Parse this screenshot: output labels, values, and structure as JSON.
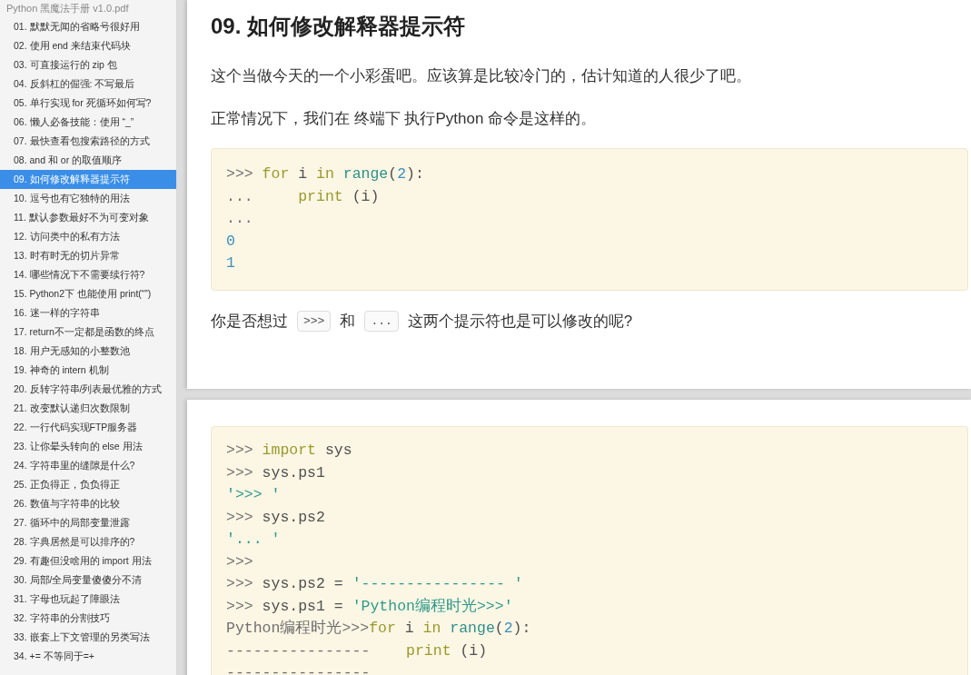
{
  "document": {
    "title": "Python 黑魔法手册 v1.0.pdf"
  },
  "outline": [
    {
      "label": "01. 默默无闻的省略号很好用",
      "selected": false
    },
    {
      "label": "02. 使用 end 来结束代码块",
      "selected": false
    },
    {
      "label": "03. 可直接运行的 zip 包",
      "selected": false
    },
    {
      "label": "04. 反斜杠的倔强: 不写最后",
      "selected": false
    },
    {
      "label": "05. 单行实现 for 死循环如何写?",
      "selected": false
    },
    {
      "label": "06. 懒人必备技能：使用 “_”",
      "selected": false
    },
    {
      "label": "07. 最快查看包搜索路径的方式",
      "selected": false
    },
    {
      "label": "08. and 和 or 的取值顺序",
      "selected": false
    },
    {
      "label": "09. 如何修改解释器提示符",
      "selected": true
    },
    {
      "label": "10. 逗号也有它独特的用法",
      "selected": false
    },
    {
      "label": "11. 默认参数最好不为可变对象",
      "selected": false
    },
    {
      "label": "12. 访问类中的私有方法",
      "selected": false
    },
    {
      "label": "13. 时有时无的切片异常",
      "selected": false
    },
    {
      "label": "14. 哪些情况下不需要续行符?",
      "selected": false
    },
    {
      "label": "15. Python2下 也能使用 print(“”)",
      "selected": false
    },
    {
      "label": "16. 迷一样的字符串",
      "selected": false
    },
    {
      "label": "17. return不一定都是函数的终点",
      "selected": false
    },
    {
      "label": "18. 用户无感知的小整数池",
      "selected": false
    },
    {
      "label": "19. 神奇的 intern 机制",
      "selected": false
    },
    {
      "label": "20. 反转字符串/列表最优雅的方式",
      "selected": false
    },
    {
      "label": "21. 改变默认递归次数限制",
      "selected": false
    },
    {
      "label": "22. 一行代码实现FTP服务器",
      "selected": false
    },
    {
      "label": "23. 让你晕头转向的 else 用法",
      "selected": false
    },
    {
      "label": "24. 字符串里的缝隙是什么?",
      "selected": false
    },
    {
      "label": "25. 正负得正，负负得正",
      "selected": false
    },
    {
      "label": "26. 数值与字符串的比较",
      "selected": false
    },
    {
      "label": "27. 循环中的局部变量泄露",
      "selected": false
    },
    {
      "label": "28. 字典居然是可以排序的?",
      "selected": false
    },
    {
      "label": "29. 有趣但没啥用的 import 用法",
      "selected": false
    },
    {
      "label": "30. 局部/全局变量傻傻分不清",
      "selected": false
    },
    {
      "label": "31. 字母也玩起了障眼法",
      "selected": false
    },
    {
      "label": "32. 字符串的分割技巧",
      "selected": false
    },
    {
      "label": "33. 嵌套上下文管理的另类写法",
      "selected": false
    },
    {
      "label": "34. += 不等同于=+",
      "selected": false
    }
  ],
  "pages": [
    {
      "heading": "09. 如何修改解释器提示符",
      "blocks": [
        {
          "kind": "paragraph",
          "text": "这个当做今天的一个小彩蛋吧。应该算是比较冷门的，估计知道的人很少了吧。"
        },
        {
          "kind": "paragraph",
          "text": "正常情况下，我们在 终端下 执行Python 命令是这样的。"
        },
        {
          "kind": "code",
          "lines": [
            [
              {
                "kind": "prompt",
                "s": ">>> "
              },
              {
                "kind": "keyword",
                "s": "for"
              },
              {
                "kind": "plain",
                "s": " i "
              },
              {
                "kind": "keyword",
                "s": "in"
              },
              {
                "kind": "builtin",
                "s": " range"
              },
              {
                "kind": "plain",
                "s": "("
              },
              {
                "kind": "number",
                "s": "2"
              },
              {
                "kind": "plain",
                "s": "):"
              }
            ],
            [
              {
                "kind": "prompt",
                "s": "...     "
              },
              {
                "kind": "keyword",
                "s": "print"
              },
              {
                "kind": "plain",
                "s": " (i)"
              }
            ],
            [
              {
                "kind": "prompt",
                "s": "..."
              }
            ],
            [
              {
                "kind": "number",
                "s": "0"
              }
            ],
            [
              {
                "kind": "number",
                "s": "1"
              }
            ]
          ]
        },
        {
          "kind": "inline",
          "parts": [
            {
              "kind": "text",
              "s": "你是否想过"
            },
            {
              "kind": "code",
              "s": ">>>"
            },
            {
              "kind": "text",
              "s": "和"
            },
            {
              "kind": "code",
              "s": "..."
            },
            {
              "kind": "text",
              "s": "这两个提示符也是可以修改的呢?"
            }
          ]
        }
      ]
    },
    {
      "blocks": [
        {
          "kind": "code",
          "lines": [
            [
              {
                "kind": "prompt",
                "s": ">>> "
              },
              {
                "kind": "keyword",
                "s": "import"
              },
              {
                "kind": "plain",
                "s": " sys"
              }
            ],
            [
              {
                "kind": "prompt",
                "s": ">>> "
              },
              {
                "kind": "plain",
                "s": "sys.ps1"
              }
            ],
            [
              {
                "kind": "string",
                "s": "'>>> '"
              }
            ],
            [
              {
                "kind": "prompt",
                "s": ">>> "
              },
              {
                "kind": "plain",
                "s": "sys.ps2"
              }
            ],
            [
              {
                "kind": "string",
                "s": "'... '"
              }
            ],
            [
              {
                "kind": "prompt",
                "s": ">>>"
              }
            ],
            [
              {
                "kind": "prompt",
                "s": ">>> "
              },
              {
                "kind": "plain",
                "s": "sys.ps2 = "
              },
              {
                "kind": "string",
                "s": "'---------------- '"
              }
            ],
            [
              {
                "kind": "prompt",
                "s": ">>> "
              },
              {
                "kind": "plain",
                "s": "sys.ps1 = "
              },
              {
                "kind": "string",
                "s": "'Python编程时光>>>'"
              }
            ],
            [
              {
                "kind": "prompt",
                "s": "Python编程时光>>>"
              },
              {
                "kind": "keyword",
                "s": "for"
              },
              {
                "kind": "plain",
                "s": " i "
              },
              {
                "kind": "keyword",
                "s": "in"
              },
              {
                "kind": "builtin",
                "s": " range"
              },
              {
                "kind": "plain",
                "s": "("
              },
              {
                "kind": "number",
                "s": "2"
              },
              {
                "kind": "plain",
                "s": "):"
              }
            ],
            [
              {
                "kind": "prompt",
                "s": "----------------    "
              },
              {
                "kind": "keyword",
                "s": "print"
              },
              {
                "kind": "plain",
                "s": " (i)"
              }
            ],
            [
              {
                "kind": "prompt",
                "s": "----------------"
              }
            ]
          ]
        }
      ]
    }
  ]
}
